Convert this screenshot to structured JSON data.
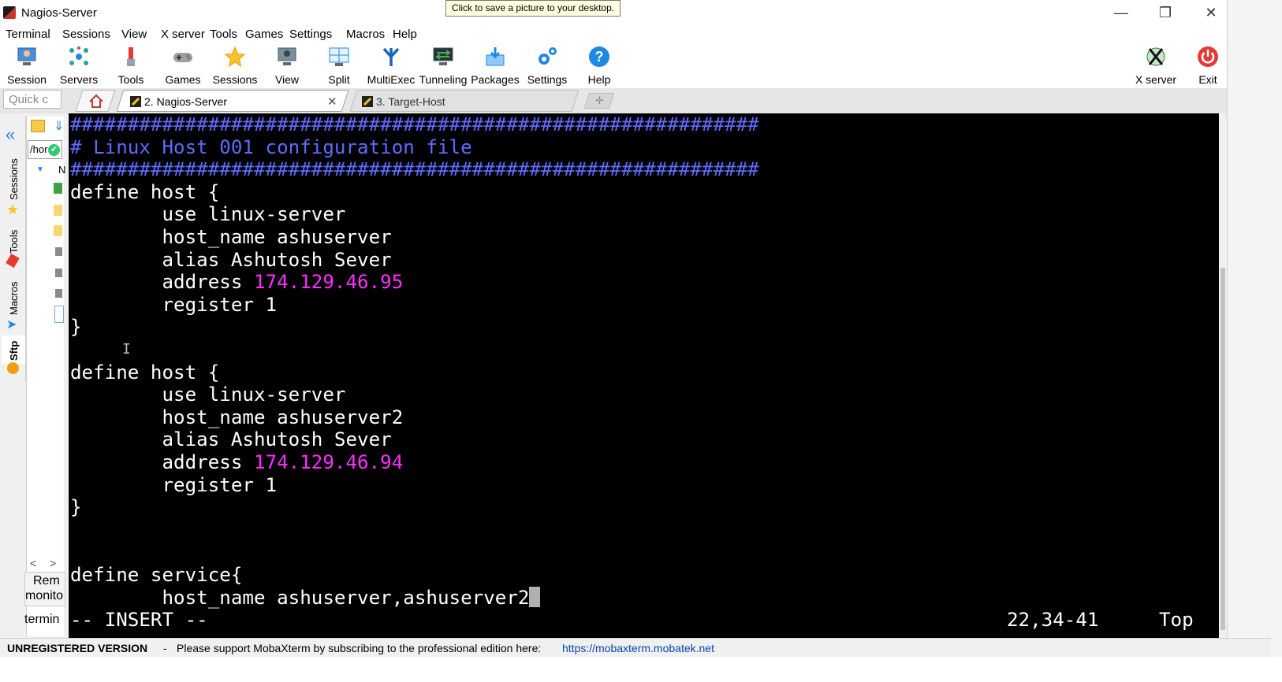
{
  "window": {
    "title": "Nagios-Server",
    "tooltip": "Click to save a picture to your desktop.",
    "minimize": "—",
    "restore": "❐",
    "close": "✕"
  },
  "menu": [
    "Terminal",
    "Sessions",
    "View",
    "X server",
    "Tools",
    "Games",
    "Settings",
    "Macros",
    "Help"
  ],
  "toolbar": {
    "items": [
      {
        "label": "Session",
        "icon": "session-monitor-icon"
      },
      {
        "label": "Servers",
        "icon": "servers-network-icon"
      },
      {
        "label": "Tools",
        "icon": "tools-icon"
      },
      {
        "label": "Games",
        "icon": "gamepad-icon"
      },
      {
        "label": "Sessions",
        "icon": "star-icon"
      },
      {
        "label": "View",
        "icon": "view-monitor-icon"
      },
      {
        "label": "Split",
        "icon": "split-screen-icon"
      },
      {
        "label": "MultiExec",
        "icon": "multiexec-fork-icon"
      },
      {
        "label": "Tunneling",
        "icon": "tunneling-icon"
      },
      {
        "label": "Packages",
        "icon": "packages-icon"
      },
      {
        "label": "Settings",
        "icon": "settings-gears-icon"
      },
      {
        "label": "Help",
        "icon": "help-question-icon"
      }
    ],
    "xserver_label": "X server",
    "exit_label": "Exit"
  },
  "quick_connect": {
    "placeholder": "Quick c"
  },
  "tabs": [
    {
      "title": "2. Nagios-Server",
      "active": true
    },
    {
      "title": "3. Target-Host",
      "active": false
    }
  ],
  "sidebar": {
    "vertical_tabs": [
      "Sessions",
      "Tools",
      "Macros",
      "Sftp"
    ],
    "path": "/hor",
    "remote_label": "Rem",
    "monitor_label": "monito",
    "terminal_label": "termin",
    "tree_marker": "N"
  },
  "terminal": {
    "lines": [
      {
        "text": "############################################################",
        "color": "blue"
      },
      {
        "text": "# Linux Host 001 configuration file",
        "color": "blue"
      },
      {
        "text": "############################################################",
        "color": "blue"
      },
      {
        "text": "define host {"
      },
      {
        "text": "        use linux-server"
      },
      {
        "text": "        host_name ashuserver"
      },
      {
        "text": "        alias Ashutosh Sever"
      },
      {
        "text": "        address ",
        "value": "174.129.46.95"
      },
      {
        "text": "        register 1"
      },
      {
        "text": "}"
      },
      {
        "text": ""
      },
      {
        "text": "define host {"
      },
      {
        "text": "        use linux-server"
      },
      {
        "text": "        host_name ashuserver2"
      },
      {
        "text": "        alias Ashutosh Sever"
      },
      {
        "text": "        address ",
        "value": "174.129.46.94"
      },
      {
        "text": "        register 1"
      },
      {
        "text": "}"
      },
      {
        "text": ""
      },
      {
        "text": ""
      },
      {
        "text": "define service{"
      },
      {
        "text": "        host_name ashuserver,ashuserver2",
        "cursor": true
      }
    ],
    "mode": "-- INSERT --",
    "position": "22,34-41",
    "scroll": "Top",
    "colors": {
      "background": "#000000",
      "text": "#ffffff",
      "comment": "#5e6bff",
      "number": "#ff2cff"
    }
  },
  "status": {
    "unregistered": "UNREGISTERED VERSION",
    "separator": "-",
    "message": "Please support MobaXterm by subscribing to the professional edition here:",
    "link": "https://mobaxterm.mobatek.net"
  }
}
